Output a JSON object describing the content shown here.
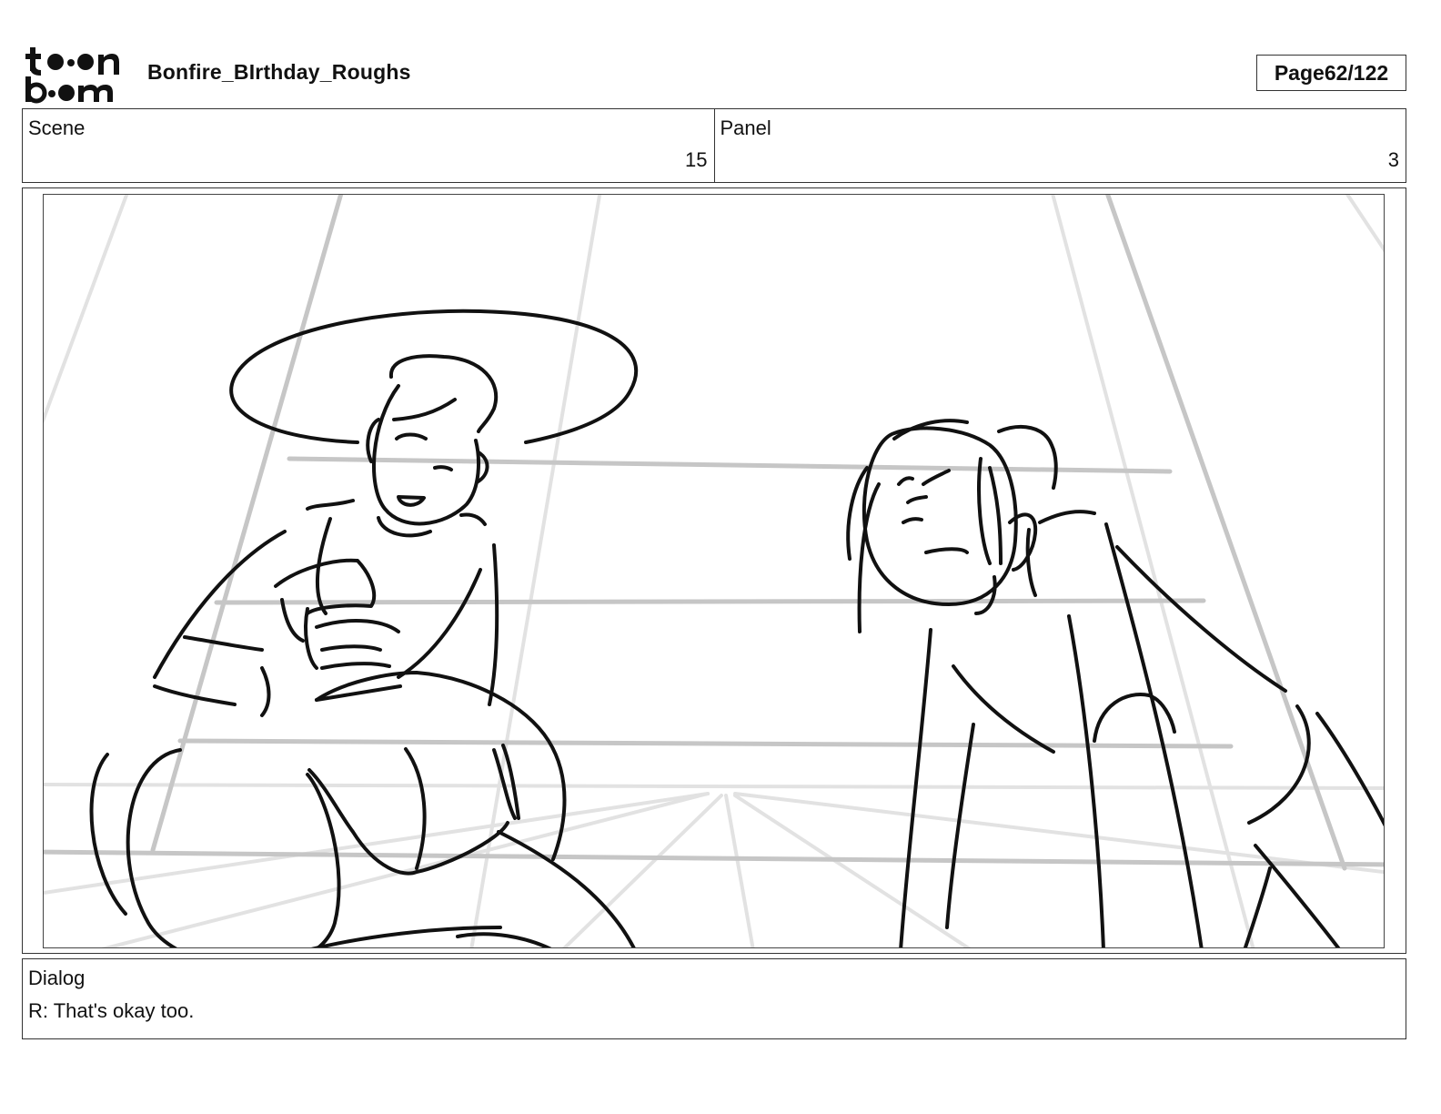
{
  "header": {
    "logo_text": "toon boom",
    "document_title": "Bonfire_BIrthday_Roughs",
    "page_label": "Page",
    "page_number": "62/122"
  },
  "scene": {
    "label": "Scene",
    "value": "15"
  },
  "panel": {
    "label": "Panel",
    "value": "3"
  },
  "dialog": {
    "label": "Dialog",
    "text": "R: That's okay too."
  }
}
